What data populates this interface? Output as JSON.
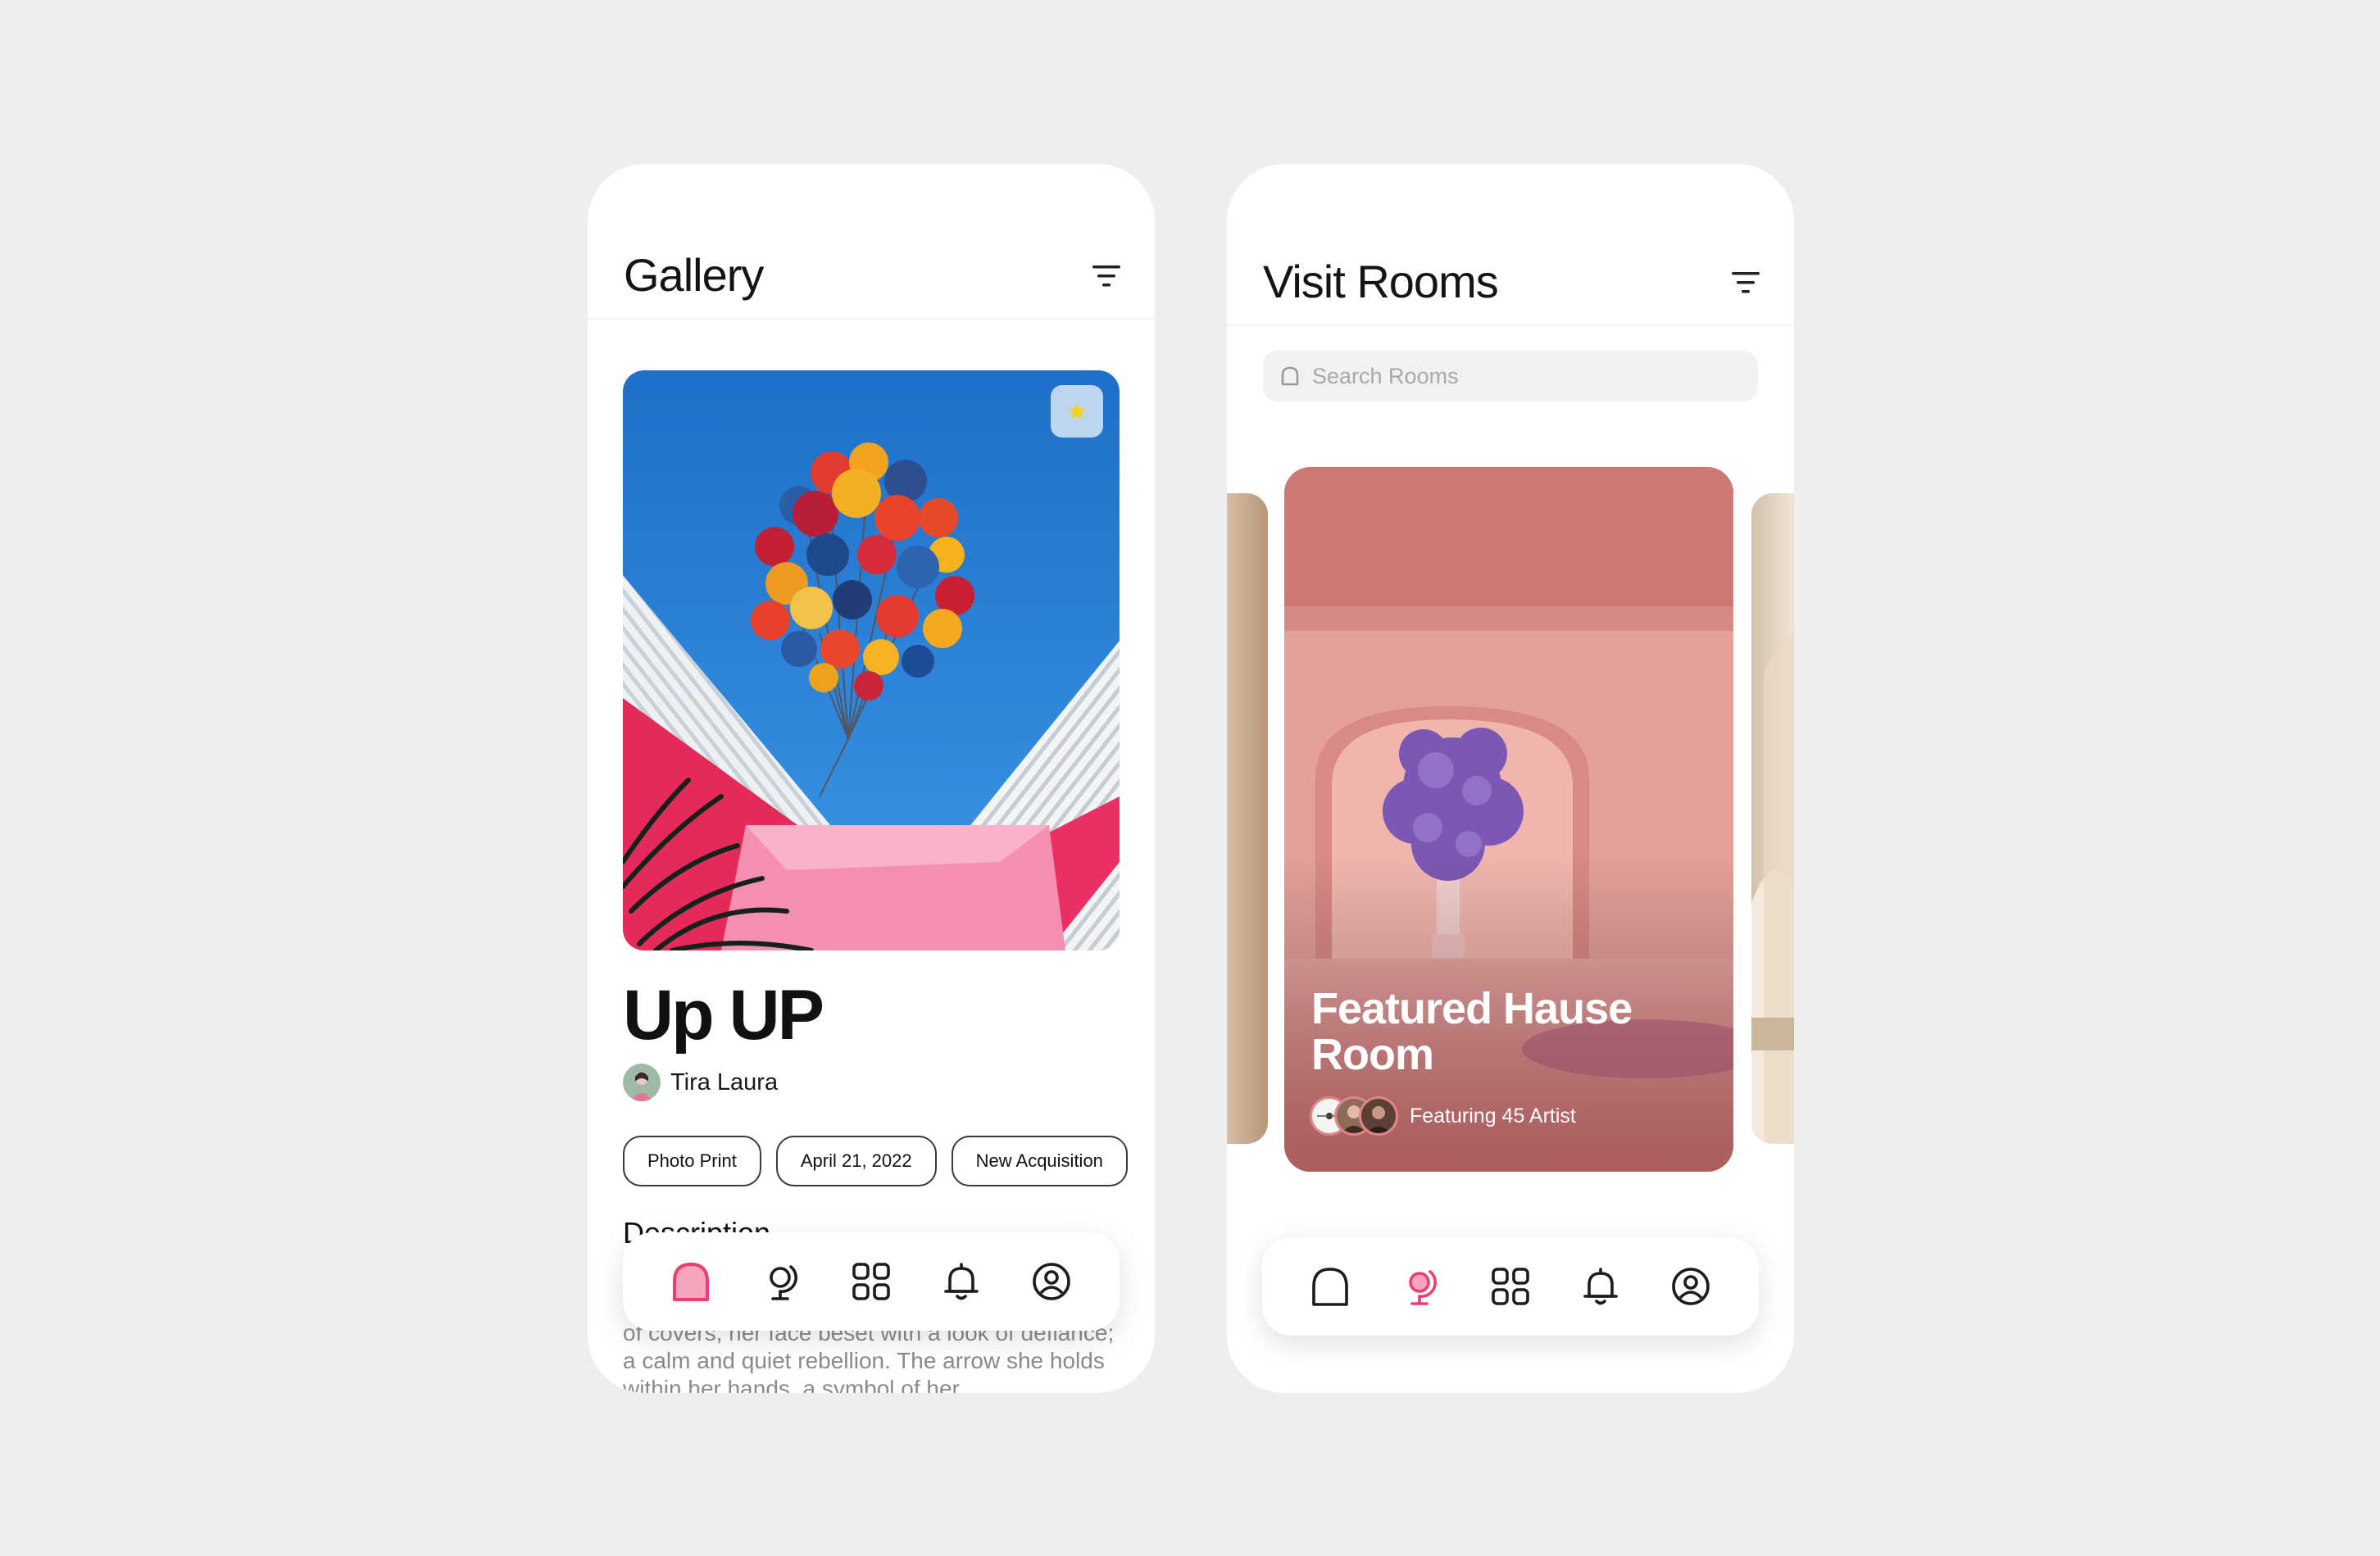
{
  "gallery": {
    "title": "Gallery",
    "artwork": {
      "title": "Up UP",
      "artist": "Tira Laura",
      "tags": [
        "Photo Print",
        "April 21, 2022",
        "New Acquisition"
      ],
      "description_heading": "Description",
      "description_text": "of covers, her face beset with a look of defiance; a calm and quiet rebellion. The arrow she holds within her hands, a symbol of her"
    }
  },
  "rooms": {
    "title": "Visit Rooms",
    "search": {
      "placeholder": "Search Rooms"
    },
    "featured": {
      "title": "Featured Hause Room",
      "subtitle": "Featuring 45 Artist"
    }
  },
  "navigation": {
    "items": [
      {
        "icon": "arch-home-icon"
      },
      {
        "icon": "globe-icon"
      },
      {
        "icon": "grid-icon"
      },
      {
        "icon": "bell-icon"
      },
      {
        "icon": "profile-icon"
      }
    ],
    "gallery_active_index": 0,
    "rooms_active_index": 1
  },
  "colors": {
    "accent": "#e8416f",
    "background": "#eeeeee",
    "card": "#ffffff",
    "text": "#141414",
    "muted": "#8a8a8a"
  }
}
